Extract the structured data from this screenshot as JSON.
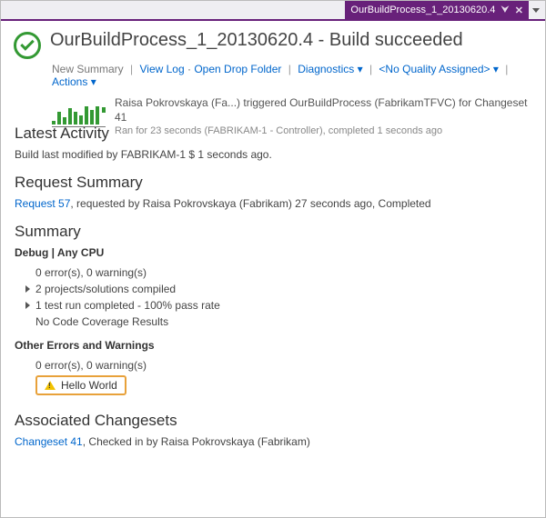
{
  "tab": {
    "title": "OurBuildProcess_1_20130620.4"
  },
  "header": {
    "title": "OurBuildProcess_1_20130620.4 - Build succeeded"
  },
  "linkbar": {
    "new_summary": "New Summary",
    "view_log": "View Log",
    "open_drop": "Open Drop Folder",
    "diagnostics": "Diagnostics",
    "quality": "<No Quality Assigned>",
    "actions": "Actions"
  },
  "info": {
    "line1": "Raisa Pokrovskaya (Fa...) triggered OurBuildProcess (FabrikamTFVC) for Changeset 41",
    "line2": "Ran for 23 seconds (FABRIKAM-1 - Controller), completed 1 seconds ago"
  },
  "latest": {
    "heading": "Latest Activity",
    "text": "Build last modified by FABRIKAM-1 $ 1 seconds ago."
  },
  "request": {
    "heading": "Request Summary",
    "link": "Request 57",
    "rest": ", requested by Raisa Pokrovskaya (Fabrikam) 27 seconds ago, Completed"
  },
  "summary": {
    "heading": "Summary",
    "config": "Debug  |  Any CPU",
    "r1": "0 error(s), 0 warning(s)",
    "r2": "2 projects/solutions compiled",
    "r3": "1 test run completed - 100% pass rate",
    "r4": "No Code Coverage Results",
    "other": "Other Errors and Warnings",
    "o1": "0 error(s), 0 warning(s)",
    "o2": "Hello World"
  },
  "assoc": {
    "heading": "Associated Changesets",
    "link": "Changeset 41",
    "rest": ", Checked in by Raisa Pokrovskaya (Fabrikam)"
  }
}
